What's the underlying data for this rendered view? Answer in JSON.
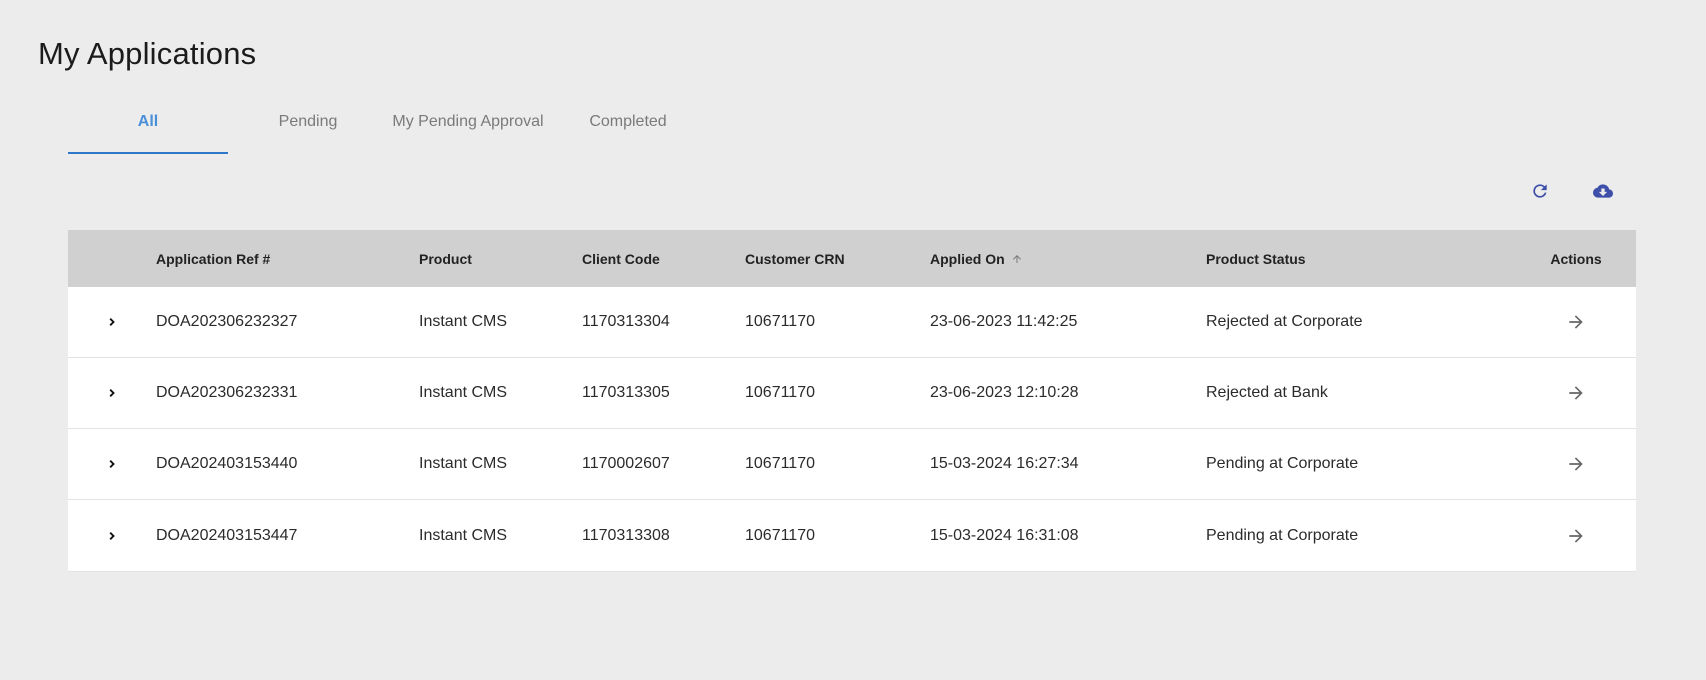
{
  "page": {
    "title": "My Applications"
  },
  "tabs": [
    {
      "label": "All",
      "active": true
    },
    {
      "label": "Pending",
      "active": false
    },
    {
      "label": "My Pending Approval",
      "active": false
    },
    {
      "label": "Completed",
      "active": false
    }
  ],
  "toolbar": {
    "refresh_icon": "refresh-icon",
    "download_icon": "cloud-download-icon",
    "icon_color": "#3d4fa8"
  },
  "table": {
    "headers": {
      "ref": "Application Ref #",
      "product": "Product",
      "client": "Client Code",
      "crn": "Customer CRN",
      "applied": "Applied On",
      "status": "Product Status",
      "actions": "Actions"
    },
    "sort": {
      "column": "applied",
      "direction": "ascending",
      "icon": "arrow-up-icon"
    },
    "rows": [
      {
        "ref": "DOA202306232327",
        "product": "Instant CMS",
        "client": "1170313304",
        "crn": "10671170",
        "applied": "23-06-2023 11:42:25",
        "status": "Rejected at Corporate"
      },
      {
        "ref": "DOA202306232331",
        "product": "Instant CMS",
        "client": "1170313305",
        "crn": "10671170",
        "applied": "23-06-2023 12:10:28",
        "status": "Rejected at Bank"
      },
      {
        "ref": "DOA202403153440",
        "product": "Instant CMS",
        "client": "1170002607",
        "crn": "10671170",
        "applied": "15-03-2024 16:27:34",
        "status": "Pending at Corporate"
      },
      {
        "ref": "DOA202403153447",
        "product": "Instant CMS",
        "client": "1170313308",
        "crn": "10671170",
        "applied": "15-03-2024 16:31:08",
        "status": "Pending at Corporate"
      }
    ]
  },
  "colors": {
    "background": "#ececec",
    "header_bg": "#d0d0d0",
    "active_tab": "#4a90d9",
    "tab_underline": "#2f78c9"
  }
}
